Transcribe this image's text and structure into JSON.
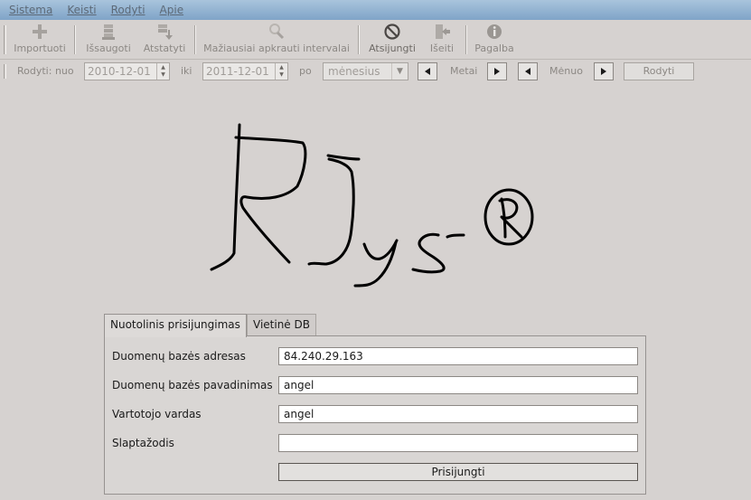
{
  "menu": {
    "items": [
      "Sistema",
      "Keisti",
      "Rodyti",
      "Apie"
    ]
  },
  "toolbar": {
    "import_label": "Importuoti",
    "save_label": "Išsaugoti",
    "restore_label": "Atstatyti",
    "least_loaded_label": "Mažiausiai apkrauti intervalai",
    "disconnect_label": "Atsijungti",
    "exit_label": "Išeiti",
    "help_label": "Pagalba"
  },
  "filter": {
    "from_label": "Rodyti: nuo",
    "from_value": "2010-12-01",
    "to_label": "iki",
    "to_value": "2011-12-01",
    "by_label": "po",
    "period_value": "mėnesius",
    "year_label": "Metai",
    "month_label": "Mėnuo",
    "show_button": "Rodyti"
  },
  "tabs": {
    "remote": "Nuotolinis prisijungimas",
    "local": "Vietinė DB"
  },
  "form": {
    "db_address_label": "Duomenų bazės adresas",
    "db_address_value": "84.240.29.163",
    "db_name_label": "Duomenų bazės pavadinimas",
    "db_name_value": "angel",
    "username_label": "Vartotojo vardas",
    "username_value": "angel",
    "password_label": "Slaptažodis",
    "password_value": "",
    "connect_button": "Prisijungti"
  },
  "colors": {
    "background": "#d6d2d0",
    "menubar": "#8fb0d0",
    "disabled_text": "#8c8884"
  }
}
